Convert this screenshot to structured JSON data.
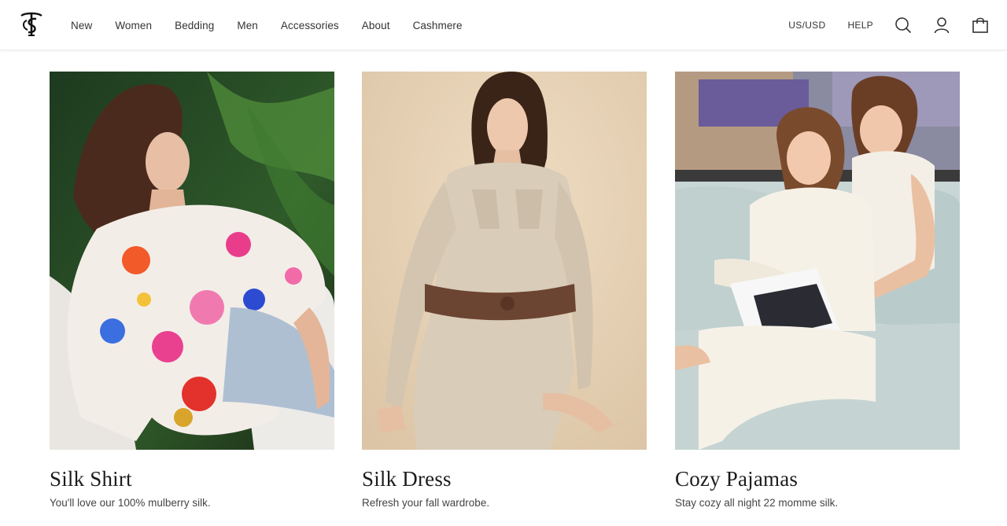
{
  "nav": {
    "items": [
      {
        "label": "New"
      },
      {
        "label": "Women"
      },
      {
        "label": "Bedding"
      },
      {
        "label": "Men"
      },
      {
        "label": "Accessories"
      },
      {
        "label": "About"
      },
      {
        "label": "Cashmere"
      }
    ]
  },
  "utilities": {
    "currency": "US/USD",
    "help": "HELP",
    "icons": [
      "search-icon",
      "account-icon",
      "shopping-bag-icon"
    ]
  },
  "logo": {
    "icon": "ts-monogram-logo"
  },
  "products": [
    {
      "title": "Silk Shirt",
      "subtitle": "You'll love our 100% mulberry silk.",
      "image": "woman in floral silk shirt and denim shorts seated in white chair"
    },
    {
      "title": "Silk Dress",
      "subtitle": "Refresh your fall wardrobe.",
      "image": "woman in beige silk shirt dress with brown belt seated"
    },
    {
      "title": "Cozy Pajamas",
      "subtitle": "Stay cozy all night 22 momme silk.",
      "image": "two women in silk pajamas reading magazine on sofa"
    }
  ],
  "colors": {
    "text": "#333333",
    "title": "#1c1c1c",
    "background": "#ffffff"
  }
}
